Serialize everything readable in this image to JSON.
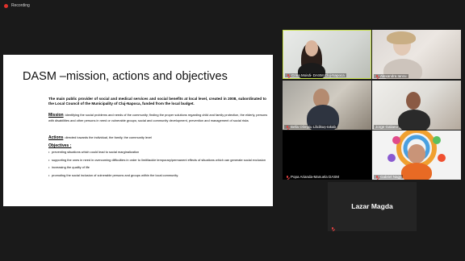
{
  "recording": {
    "label": "Recording"
  },
  "slide": {
    "title": "DASM –mission, actions and objectives",
    "intro": "The main public provider of social and medical services and social benefits at local level, created in 2008, subordinated to the Local Council of the Municipality of Cluj-Napoca, funded from the local budget.",
    "mission_head": "Mission",
    "mission_text": ": identifying the social problems and needs of the community; finding the proper solutions regarding child and family protection, the elderly, persons with disabilities and other persons in need or vulnerable groups; social and community development, prevention and management of social risks",
    "actions_head": "Actions",
    "actions_text": ": directed towards the individual, the family, the community level",
    "objectives_head": "Objectives :",
    "objectives": [
      "preventing situations which could lead to social marginalization",
      "supporting the ones in need in overcoming difficulties in order to limit/tackle temporary/permanent effects of situations which can generate social exclusion",
      "increasing the quality of life",
      "promoting the social inclusion of vulnerable persons and groups within the local community."
    ]
  },
  "participants": [
    {
      "name": "Crina Moisă- DASM Cluj-Napoca",
      "speaking": true
    },
    {
      "name": "Alexandra Iancu"
    },
    {
      "name": "Bella Olimpiu Lăcătuș-Iakab"
    },
    {
      "name": "Jorge Galiano"
    },
    {
      "name": "Popa Arianda-Manuela DASM"
    },
    {
      "name": "Gabriel Nagy"
    },
    {
      "name": "Lazar Magda",
      "display_text": "Lazar Magda",
      "video_off": true
    }
  ],
  "colors": {
    "active_speaker_border": "#c8e04a",
    "muted_mic": "#e04040",
    "background": "#1a1a1a"
  }
}
